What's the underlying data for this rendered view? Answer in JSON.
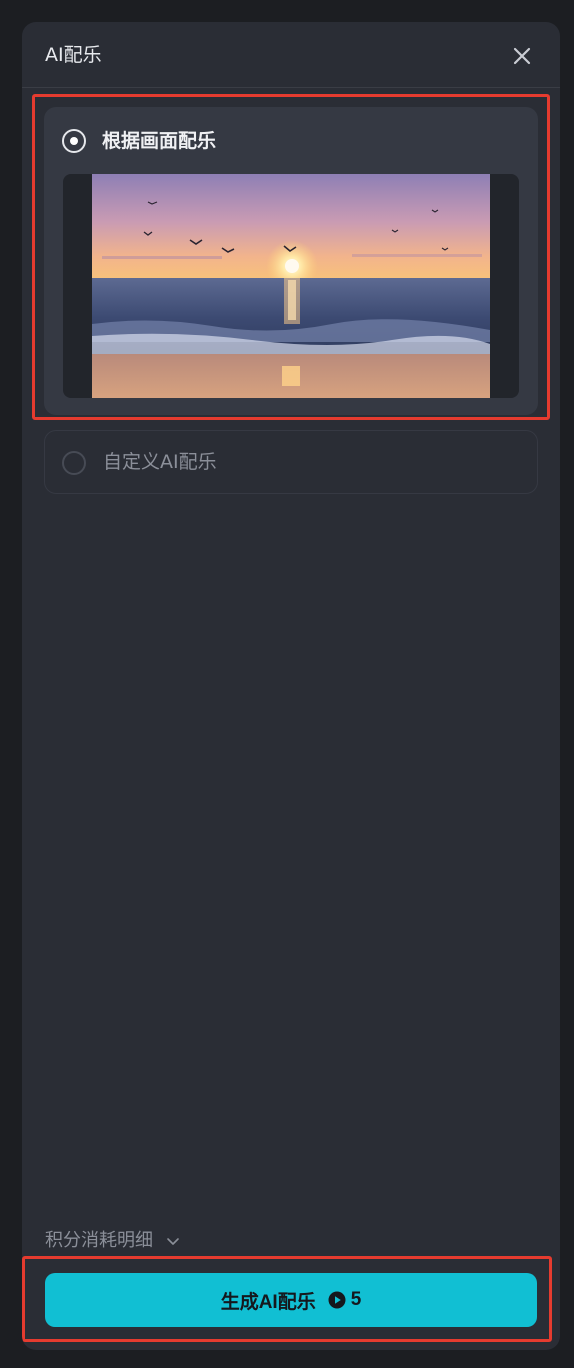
{
  "panel": {
    "title": "AI配乐"
  },
  "options": [
    {
      "label": "根据画面配乐",
      "selected": true
    },
    {
      "label": "自定义AI配乐",
      "selected": false
    }
  ],
  "footer": {
    "cost_detail_label": "积分消耗明细",
    "generate_label": "生成AI配乐",
    "points_cost": "5"
  },
  "colors": {
    "panel_bg": "#2a2d35",
    "accent": "#11bfd3",
    "highlight_box": "#e53b2f"
  },
  "icons": {
    "close": "close-icon",
    "chevron": "chevron-down-icon",
    "points": "play-circle-icon"
  }
}
